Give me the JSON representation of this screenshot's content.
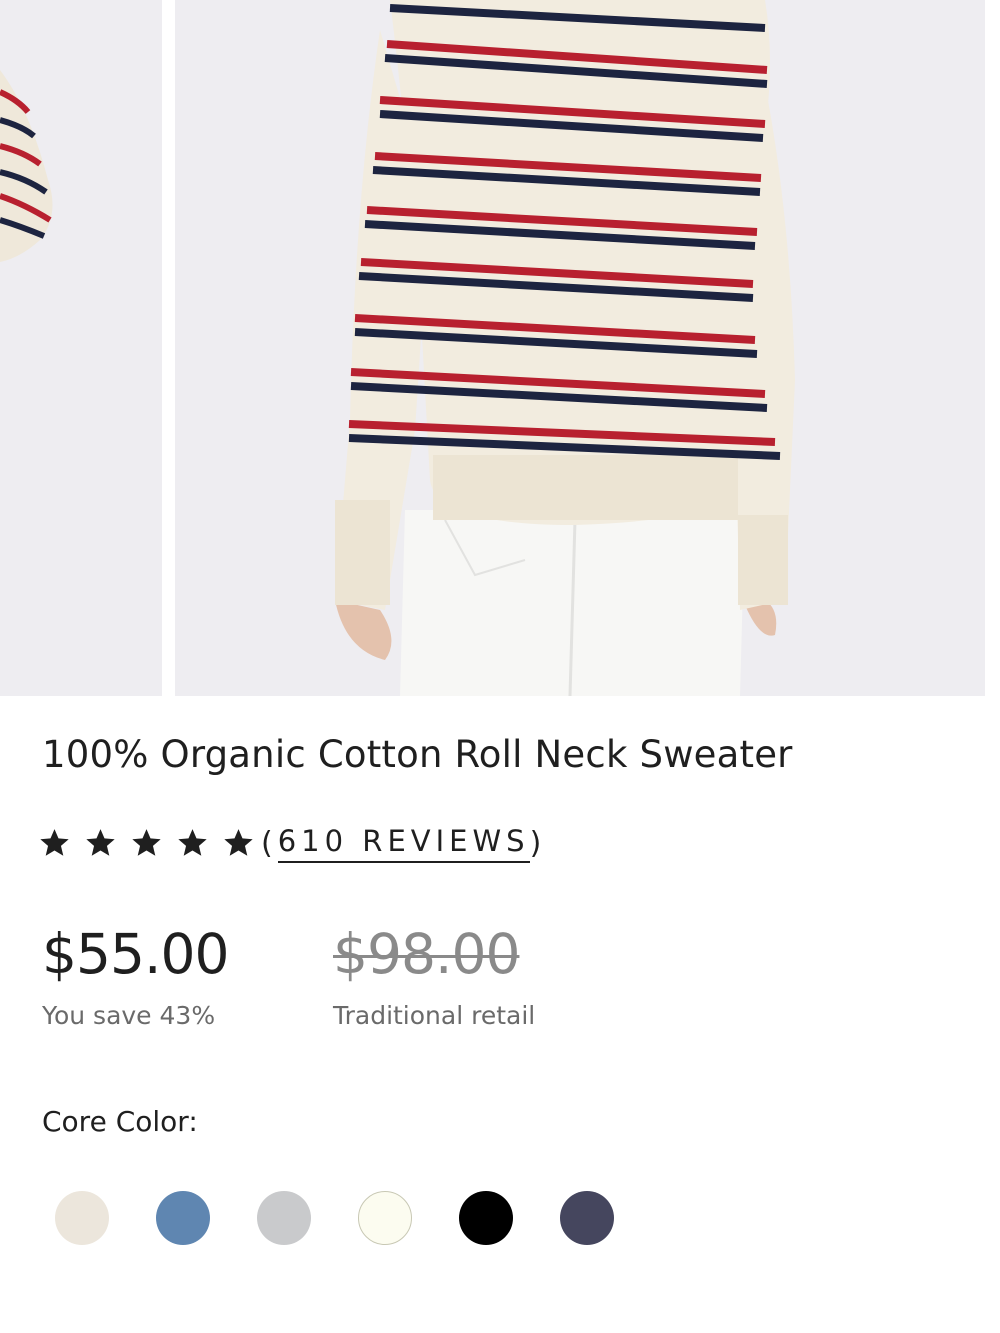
{
  "product": {
    "title": "100% Organic Cotton Roll Neck Sweater",
    "rating": 5,
    "reviews_open": "(",
    "reviews_label": "610 REVIEWS",
    "reviews_close": ")",
    "price": "$55.00",
    "savings": "You save 43%",
    "retail_price": "$98.00",
    "retail_label": "Traditional retail"
  },
  "colors": {
    "label": "Core Color:",
    "swatches": [
      {
        "name": "ivory",
        "hex": "#ece6dc"
      },
      {
        "name": "blue",
        "hex": "#5f86b1"
      },
      {
        "name": "grey",
        "hex": "#c9cacc"
      },
      {
        "name": "cream",
        "hex": "#fcfcf0"
      },
      {
        "name": "black",
        "hex": "#000000"
      },
      {
        "name": "navy",
        "hex": "#45465e"
      }
    ]
  },
  "icons": {
    "star": "star-icon"
  }
}
